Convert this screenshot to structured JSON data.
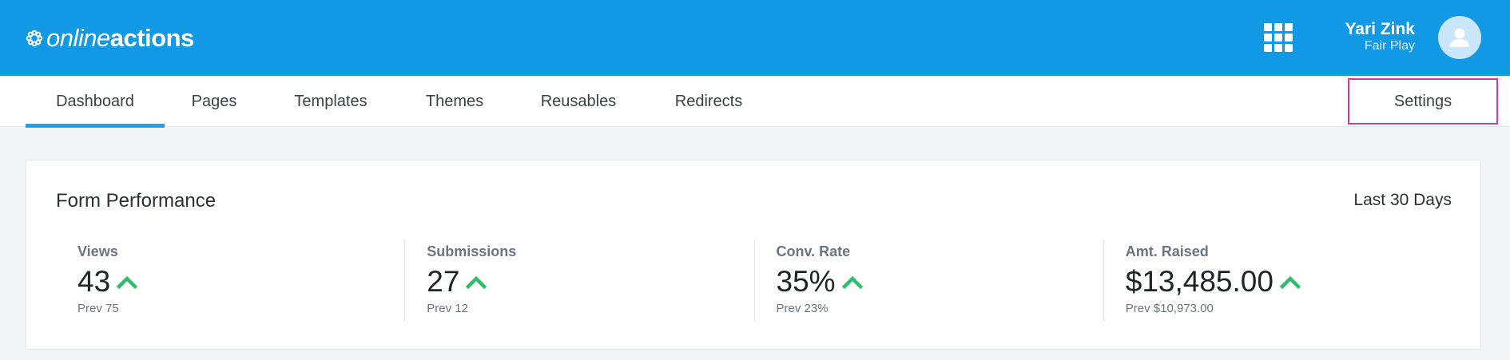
{
  "brand": {
    "logo_light": "online",
    "logo_bold": "actions",
    "header_color": "#1199e6"
  },
  "header": {
    "apps_icon": "grid-icon",
    "user_name": "Yari Zink",
    "user_org": "Fair Play",
    "avatar_icon": "user-silhouette-icon"
  },
  "tabs": [
    {
      "label": "Dashboard",
      "active": true
    },
    {
      "label": "Pages",
      "active": false
    },
    {
      "label": "Templates",
      "active": false
    },
    {
      "label": "Themes",
      "active": false
    },
    {
      "label": "Reusables",
      "active": false
    },
    {
      "label": "Redirects",
      "active": false
    },
    {
      "label": "Settings",
      "active": false,
      "highlighted": true
    }
  ],
  "card": {
    "title": "Form Performance",
    "range": "Last 30 Days",
    "metrics": [
      {
        "label": "Views",
        "value": "43",
        "trend": "up",
        "prev": "Prev 75"
      },
      {
        "label": "Submissions",
        "value": "27",
        "trend": "up",
        "prev": "Prev 12"
      },
      {
        "label": "Conv. Rate",
        "value": "35%",
        "trend": "up",
        "prev": "Prev 23%"
      },
      {
        "label": "Amt. Raised",
        "value": "$13,485.00",
        "trend": "up",
        "prev": "Prev $10,973.00"
      }
    ],
    "trend_color": "#2ebd6b",
    "highlight_color": "#d63b93"
  }
}
